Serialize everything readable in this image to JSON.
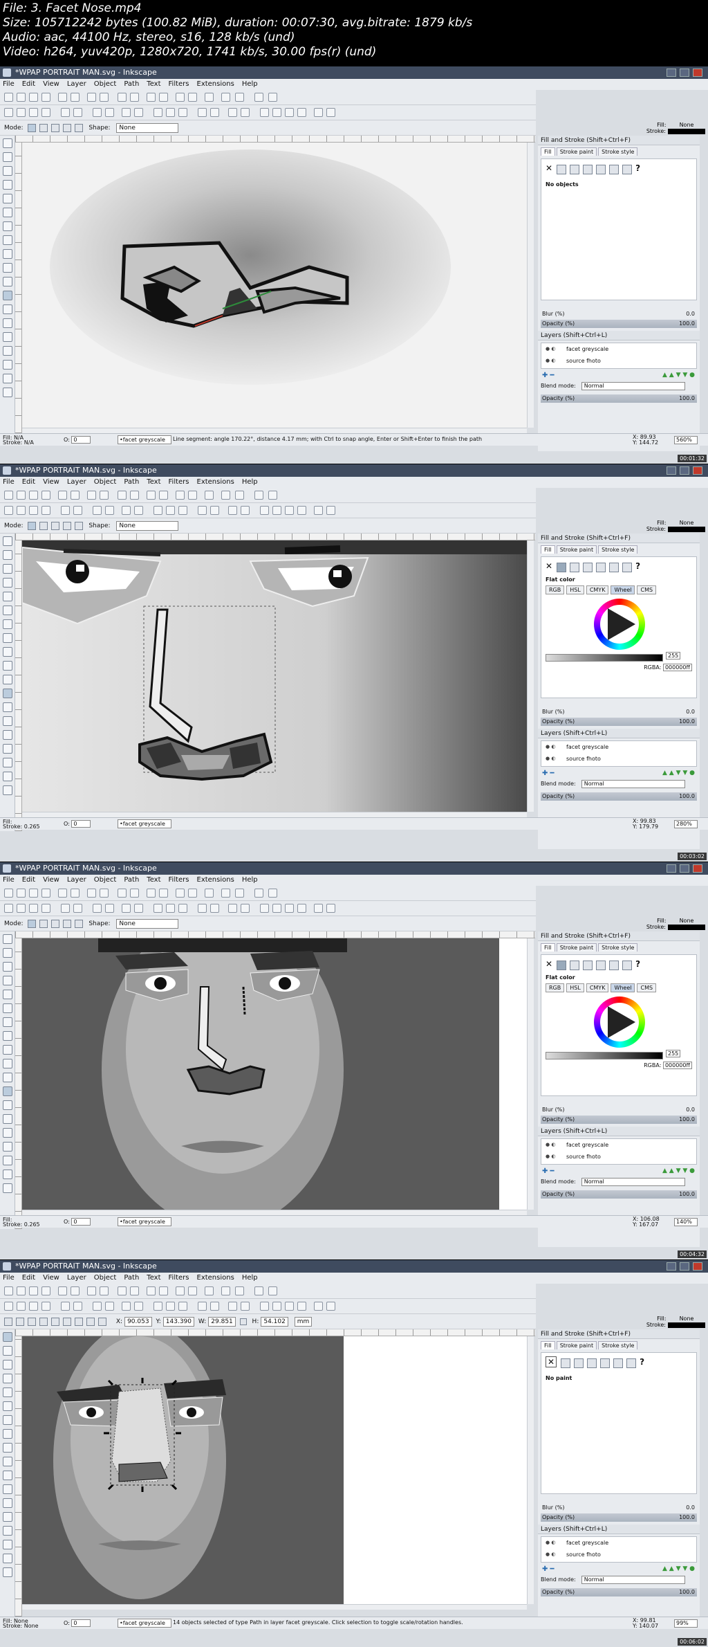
{
  "header": {
    "lines": [
      "File: 3. Facet Nose.mp4",
      "Size: 105712242 bytes (100.82 MiB), duration: 00:07:30, avg.bitrate: 1879 kb/s",
      "Audio: aac, 44100 Hz, stereo, s16, 128 kb/s (und)",
      "Video: h264, yuv420p, 1280x720, 1741 kb/s, 30.00 fps(r) (und)"
    ]
  },
  "app": {
    "title": "*WPAP PORTRAIT MAN.svg - Inkscape",
    "menus": [
      "File",
      "Edit",
      "View",
      "Layer",
      "Object",
      "Path",
      "Text",
      "Filters",
      "Extensions",
      "Help"
    ],
    "mode_label": "Mode:",
    "shape_label": "Shape:",
    "shape_value": "None",
    "fill_stroke_title": "Fill and Stroke (Shift+Ctrl+F)",
    "tab_fill": "Fill",
    "tab_stroke_paint": "Stroke paint",
    "tab_stroke_style": "Stroke style",
    "flat_color": "Flat color",
    "color_tabs": [
      "RGB",
      "HSL",
      "CMYK",
      "Wheel",
      "CMS"
    ],
    "alpha_value": "255",
    "rgba_label": "RGBA:",
    "rgba_value": "000000ff",
    "blur_label": "Blur (%)",
    "blur_value": "0.0",
    "opacity_label": "Opacity (%)",
    "opacity_value": "100.0",
    "layers_title": "Layers (Shift+Ctrl+L)",
    "layers": [
      "facet greyscale",
      "source fhoto"
    ],
    "blend_label": "Blend mode:",
    "blend_value": "Normal",
    "fill_label": "Fill:",
    "stroke_label": "Stroke:",
    "fill_value_top": "None",
    "layer_current": "•facet greyscale"
  },
  "frames": [
    {
      "timestamp": "00:01:32",
      "panel_message": "No objects",
      "status_fill": "N/A",
      "status_stroke": "N/A",
      "status_message": "Line segment: angle 170.22°, distance 4.17 mm; with Ctrl to snap angle, Enter or Shift+Enter to finish the path",
      "coord_x": "X: 89.93",
      "coord_y": "Y: 144.72",
      "zoom": "560%",
      "o_value": "0"
    },
    {
      "timestamp": "00:03:02",
      "status_stroke_w": "0.265",
      "coord_x": "X: 99.83",
      "coord_y": "Y: 179.79",
      "zoom": "280%",
      "o_value": "0"
    },
    {
      "timestamp": "00:04:32",
      "status_stroke_w": "0.265",
      "coord_x": "X: 106.08",
      "coord_y": "Y: 167.07",
      "zoom": "140%",
      "o_value": "0"
    },
    {
      "timestamp": "00:06:02",
      "panel_message": "No paint",
      "status_fill": "None",
      "status_stroke": "None",
      "status_message": "14 objects selected of type Path in layer facet greyscale. Click selection to toggle scale/rotation handles.",
      "coord_x": "X: 99.81",
      "coord_y": "Y: 140.07",
      "zoom": "99%",
      "o_value": "0",
      "sel_x": "90.053",
      "sel_y": "143.390",
      "sel_w": "29.851",
      "sel_h": "54.102",
      "sel_unit": "mm"
    }
  ]
}
